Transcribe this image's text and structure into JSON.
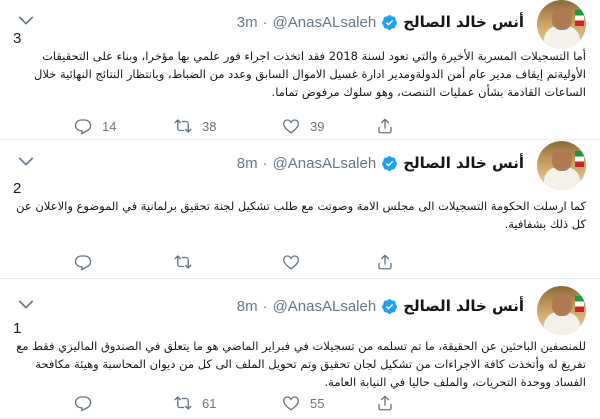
{
  "tweets": [
    {
      "author_name": "أنس خالد الصالح",
      "handle": "@AnasALsaleh",
      "separator": "·",
      "time": "3m",
      "thread_number": "3",
      "text": "أما التسجيلات المسربة الأخيرة والتي تعود لسنة 2018 فقد اتخذت اجراء فور علمي بها مؤخرا، وبناء على التحقيقات الأوليةتم إيقاف مدير عام أمن الدولةومدير ادارة غسيل الاموال السابق وعدد من الضباط، وبانتظار النتائج النهائية خلال الساعات القادمة بشأن عمليات التنصت، وهو سلوك مرفوض تماما.",
      "replies": "14",
      "retweets": "38",
      "likes": "39"
    },
    {
      "author_name": "أنس خالد الصالح",
      "handle": "@AnasALsaleh",
      "separator": "·",
      "time": "8m",
      "thread_number": "2",
      "text": "كما ارسلت الحكومة التسجيلات الى مجلس الامة وصوتت مع طلب تشكيل لجنة تحقيق برلمانية في الموضوع والاعلان عن كل ذلك بشفافية.",
      "replies": "",
      "retweets": "",
      "likes": ""
    },
    {
      "author_name": "أنس خالد الصالح",
      "handle": "@AnasALsaleh",
      "separator": "·",
      "time": "8m",
      "thread_number": "1",
      "text": "للمنصفين الباحثين عن الحقيقة، ما تم تسلمه من تسجيلات في فبراير الماضي هو ما يتعلق في الصندوق الماليزي فقط مع تفريغ له وأتخذت كافة الاجراءات من تشكيل لجان تحقيق وتم تحويل الملف الى كل من ديوان المحاسبة وهيئة مكافحة الفساد ووحدة التحريات، والملف حاليا في النيابة العامة.",
      "replies": "",
      "retweets": "61",
      "likes": "55"
    }
  ],
  "icons": {
    "verified": "verified-badge-icon",
    "caret": "chevron-down-icon",
    "reply": "reply-icon",
    "retweet": "retweet-icon",
    "like": "heart-icon",
    "share": "share-icon"
  },
  "colors": {
    "verified_blue": "#1da1f2",
    "icon_gray": "#657786",
    "divider": "#e6ecf0"
  }
}
